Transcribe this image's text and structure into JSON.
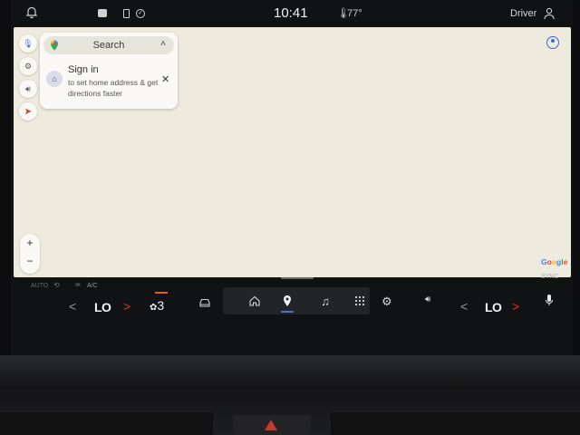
{
  "status_bar": {
    "time": "10:41",
    "temperature": "77°",
    "profile_label": "Driver"
  },
  "map": {
    "search_placeholder": "Search",
    "sign_in_title": "Sign in",
    "sign_in_subtitle": "to set home address & get directions faster",
    "zoom_in": "+",
    "zoom_out": "−",
    "attribution": "Google"
  },
  "climate": {
    "auto_label": "AUTO",
    "ac_label": "A/C",
    "sync_label": "SYNC",
    "left_temp": "LO",
    "right_temp": "LO",
    "fan_speed": "3",
    "fan_bar_color": "#e35b2a",
    "arrow_left_color": "#9a9a9a",
    "arrow_right_color": "#e0332b"
  },
  "dock": {
    "active_item": "navigation",
    "active_color": "#4b6fd8"
  },
  "icons": {
    "notification": "bell-icon",
    "message": "message-icon",
    "phone": "phone-icon",
    "check": "check-circle-icon",
    "thermometer": "thermometer-icon",
    "profile": "person-icon",
    "mic": "mic-icon",
    "settings": "gear-icon",
    "volume": "volume-icon",
    "compass": "compass-icon",
    "home": "home-icon",
    "navigation": "location-pin-icon",
    "music": "music-note-icon",
    "apps": "apps-grid-icon",
    "vehicle": "car-icon"
  }
}
